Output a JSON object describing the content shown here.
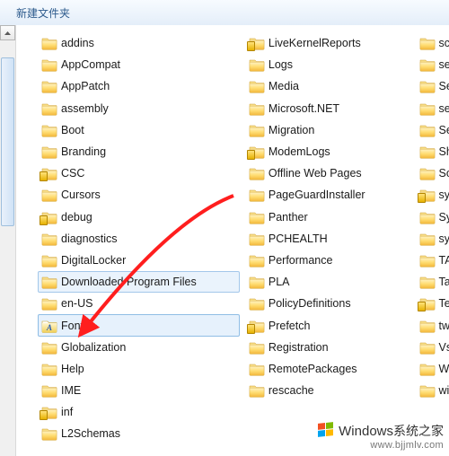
{
  "toolbar": {
    "new_folder_label": "新建文件夹"
  },
  "columns": [
    {
      "items": [
        {
          "label": "addins",
          "locked": false,
          "selected": false,
          "special": null
        },
        {
          "label": "AppCompat",
          "locked": false,
          "selected": false,
          "special": null
        },
        {
          "label": "AppPatch",
          "locked": false,
          "selected": false,
          "special": null
        },
        {
          "label": "assembly",
          "locked": false,
          "selected": false,
          "special": null
        },
        {
          "label": "Boot",
          "locked": false,
          "selected": false,
          "special": null
        },
        {
          "label": "Branding",
          "locked": false,
          "selected": false,
          "special": null
        },
        {
          "label": "CSC",
          "locked": true,
          "selected": false,
          "special": null
        },
        {
          "label": "Cursors",
          "locked": false,
          "selected": false,
          "special": null
        },
        {
          "label": "debug",
          "locked": true,
          "selected": false,
          "special": null
        },
        {
          "label": "diagnostics",
          "locked": false,
          "selected": false,
          "special": null
        },
        {
          "label": "DigitalLocker",
          "locked": false,
          "selected": false,
          "special": null
        },
        {
          "label": "Downloaded Program Files",
          "locked": false,
          "selected": "sel",
          "special": null
        },
        {
          "label": "en-US",
          "locked": false,
          "selected": false,
          "special": null
        },
        {
          "label": "Fonts",
          "locked": false,
          "selected": "sel2",
          "special": "fonts"
        },
        {
          "label": "Globalization",
          "locked": false,
          "selected": false,
          "special": null
        },
        {
          "label": "Help",
          "locked": false,
          "selected": false,
          "special": null
        },
        {
          "label": "IME",
          "locked": false,
          "selected": false,
          "special": null
        },
        {
          "label": "inf",
          "locked": true,
          "selected": false,
          "special": null
        },
        {
          "label": "L2Schemas",
          "locked": false,
          "selected": false,
          "special": null
        }
      ]
    },
    {
      "items": [
        {
          "label": "LiveKernelReports",
          "locked": true,
          "selected": false,
          "special": null
        },
        {
          "label": "Logs",
          "locked": false,
          "selected": false,
          "special": null
        },
        {
          "label": "Media",
          "locked": false,
          "selected": false,
          "special": null
        },
        {
          "label": "Microsoft.NET",
          "locked": false,
          "selected": false,
          "special": null
        },
        {
          "label": "Migration",
          "locked": false,
          "selected": false,
          "special": null
        },
        {
          "label": "ModemLogs",
          "locked": true,
          "selected": false,
          "special": null
        },
        {
          "label": "Offline Web Pages",
          "locked": false,
          "selected": false,
          "special": null
        },
        {
          "label": "PageGuardInstaller",
          "locked": false,
          "selected": false,
          "special": null
        },
        {
          "label": "Panther",
          "locked": false,
          "selected": false,
          "special": null
        },
        {
          "label": "PCHEALTH",
          "locked": false,
          "selected": false,
          "special": null
        },
        {
          "label": "Performance",
          "locked": false,
          "selected": false,
          "special": null
        },
        {
          "label": "PLA",
          "locked": false,
          "selected": false,
          "special": null
        },
        {
          "label": "PolicyDefinitions",
          "locked": false,
          "selected": false,
          "special": null
        },
        {
          "label": "Prefetch",
          "locked": true,
          "selected": false,
          "special": null
        },
        {
          "label": "Registration",
          "locked": false,
          "selected": false,
          "special": null
        },
        {
          "label": "RemotePackages",
          "locked": false,
          "selected": false,
          "special": null
        },
        {
          "label": "rescache",
          "locked": false,
          "selected": false,
          "special": null
        }
      ]
    },
    {
      "items": [
        {
          "label": "sch",
          "locked": false,
          "selected": false,
          "special": null
        },
        {
          "label": "sec",
          "locked": false,
          "selected": false,
          "special": null
        },
        {
          "label": "Ser",
          "locked": false,
          "selected": false,
          "special": null
        },
        {
          "label": "ser",
          "locked": false,
          "selected": false,
          "special": null
        },
        {
          "label": "Set",
          "locked": false,
          "selected": false,
          "special": null
        },
        {
          "label": "She",
          "locked": false,
          "selected": false,
          "special": null
        },
        {
          "label": "Sof",
          "locked": false,
          "selected": false,
          "special": null
        },
        {
          "label": "sys",
          "locked": true,
          "selected": false,
          "special": null
        },
        {
          "label": "Sys",
          "locked": false,
          "selected": false,
          "special": null
        },
        {
          "label": "sys",
          "locked": false,
          "selected": false,
          "special": null
        },
        {
          "label": "TA",
          "locked": false,
          "selected": false,
          "special": null
        },
        {
          "label": "Tas",
          "locked": false,
          "selected": false,
          "special": null
        },
        {
          "label": "Tel",
          "locked": true,
          "selected": false,
          "special": null
        },
        {
          "label": "twa",
          "locked": false,
          "selected": false,
          "special": null
        },
        {
          "label": "Vss",
          "locked": false,
          "selected": false,
          "special": null
        },
        {
          "label": "We",
          "locked": false,
          "selected": false,
          "special": null
        },
        {
          "label": "wir",
          "locked": false,
          "selected": false,
          "special": null
        }
      ]
    }
  ],
  "watermark": {
    "brand": "Windows",
    "suffix": "系统之家",
    "url": "www.bjjmlv.com"
  },
  "colors": {
    "toolbar_text": "#2c5a8c",
    "selection_bg": "#eaf3fc",
    "selection_border": "#a3c7ea",
    "arrow": "#ff1e1e"
  }
}
